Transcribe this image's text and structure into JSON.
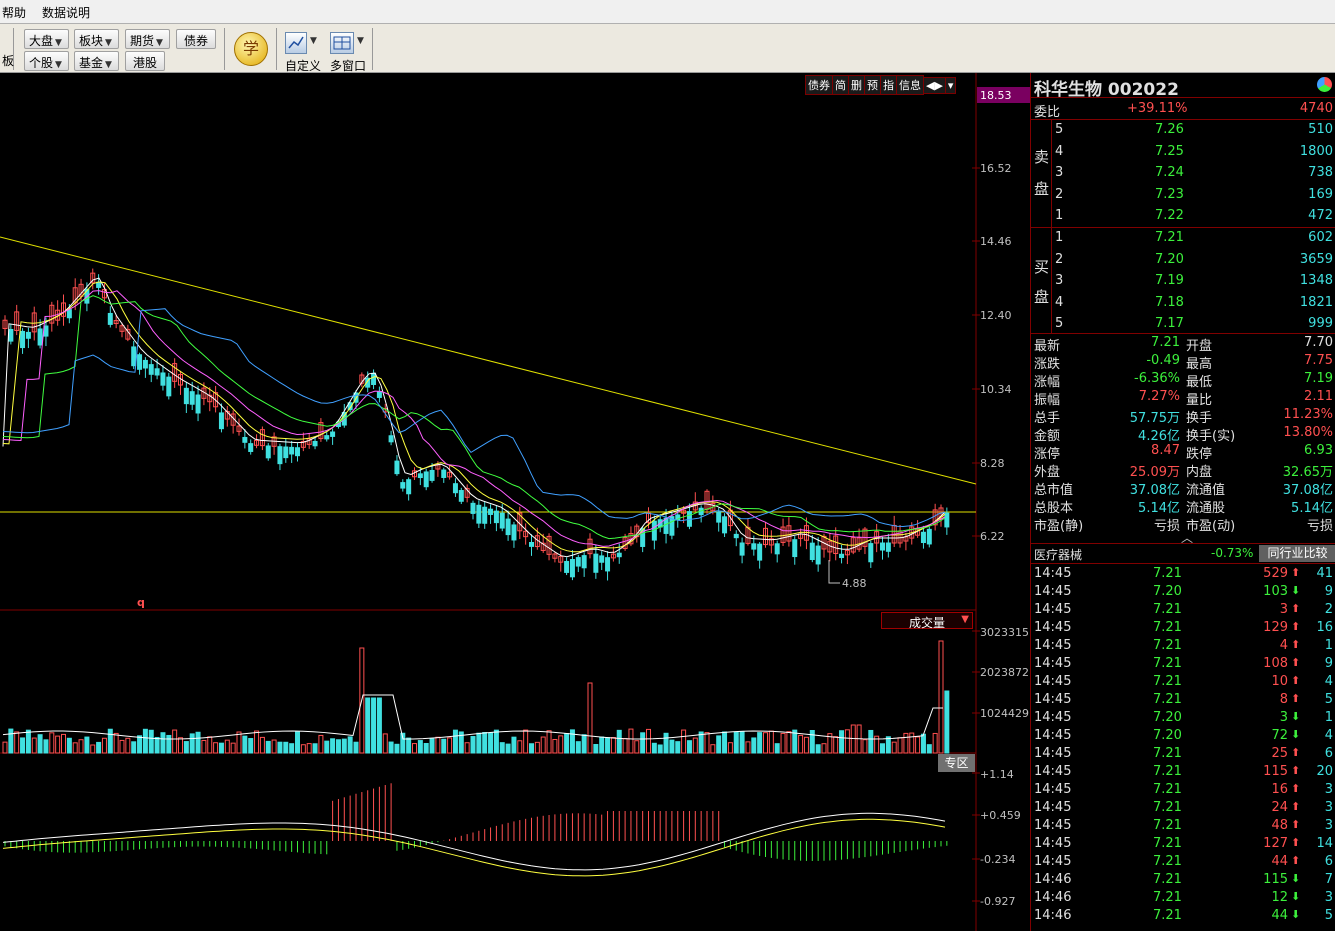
{
  "menu": [
    "帮助",
    "数据说明"
  ],
  "toolbar": {
    "left_edge": [
      "",
      "板"
    ],
    "row1": [
      "大盘",
      "板块",
      "期货",
      "债券"
    ],
    "row2": [
      "个股",
      "基金",
      "港股"
    ],
    "xue": "学",
    "custom": "自定义",
    "multi": "多窗口"
  },
  "chart_icons": [
    "债券",
    "简",
    "删",
    "预",
    "指",
    "信息",
    "◀▶"
  ],
  "price_axis": {
    "highlight": "18.53",
    "ticks": [
      "16.52",
      "14.46",
      "12.40",
      "10.34",
      "8.28",
      "6.22"
    ]
  },
  "annotations": {
    "low_label": "4.88",
    "q_mark": "q"
  },
  "volume": {
    "indicator": "成交量",
    "ticks": [
      "3023315",
      "2023872",
      "1024429"
    ],
    "zone_btn": "专区"
  },
  "macd": {
    "ticks": [
      "+1.14",
      "+0.459",
      "-0.234",
      "-0.927"
    ]
  },
  "stock": {
    "name": "科华生物",
    "code": "002022"
  },
  "weibi": {
    "label": "委比",
    "pct": "+39.11%",
    "diff": "4740"
  },
  "sell_label": [
    "卖",
    "盘"
  ],
  "buy_label": [
    "买",
    "盘"
  ],
  "sell": [
    [
      "5",
      "7.26",
      "510"
    ],
    [
      "4",
      "7.25",
      "1800"
    ],
    [
      "3",
      "7.24",
      "738"
    ],
    [
      "2",
      "7.23",
      "169"
    ],
    [
      "1",
      "7.22",
      "472"
    ]
  ],
  "buy": [
    [
      "1",
      "7.21",
      "602"
    ],
    [
      "2",
      "7.20",
      "3659"
    ],
    [
      "3",
      "7.19",
      "1348"
    ],
    [
      "4",
      "7.18",
      "1821"
    ],
    [
      "5",
      "7.17",
      "999"
    ]
  ],
  "stats": [
    [
      "最新",
      "7.21",
      "开盘",
      "7.70"
    ],
    [
      "涨跌",
      "-0.49",
      "最高",
      "7.75"
    ],
    [
      "涨幅",
      "-6.36%",
      "最低",
      "7.19"
    ],
    [
      "振幅",
      "7.27%",
      "量比",
      "2.11"
    ],
    [
      "总手",
      "57.75万",
      "换手",
      "11.23%"
    ],
    [
      "金额",
      "4.26亿",
      "换手(实)",
      "13.80%"
    ],
    [
      "涨停",
      "8.47",
      "跌停",
      "6.93"
    ],
    [
      "外盘",
      "25.09万",
      "内盘",
      "32.65万"
    ],
    [
      "总市值",
      "37.08亿",
      "流通值",
      "37.08亿"
    ],
    [
      "总股本",
      "5.14亿",
      "流通股",
      "5.14亿"
    ],
    [
      "市盈(静)",
      "亏损",
      "市盈(动)",
      "亏损"
    ]
  ],
  "industry": {
    "name": "医疗器械",
    "pct": "-0.73%",
    "button": "同行业比较"
  },
  "ticks": [
    [
      "14:45",
      "7.21",
      "529",
      "up",
      "41"
    ],
    [
      "14:45",
      "7.20",
      "103",
      "down",
      "9"
    ],
    [
      "14:45",
      "7.21",
      "3",
      "up",
      "2"
    ],
    [
      "14:45",
      "7.21",
      "129",
      "up",
      "16"
    ],
    [
      "14:45",
      "7.21",
      "4",
      "up",
      "1"
    ],
    [
      "14:45",
      "7.21",
      "108",
      "up",
      "9"
    ],
    [
      "14:45",
      "7.21",
      "10",
      "up",
      "4"
    ],
    [
      "14:45",
      "7.21",
      "8",
      "up",
      "5"
    ],
    [
      "14:45",
      "7.20",
      "3",
      "down",
      "1"
    ],
    [
      "14:45",
      "7.20",
      "72",
      "down",
      "4"
    ],
    [
      "14:45",
      "7.21",
      "25",
      "up",
      "6"
    ],
    [
      "14:45",
      "7.21",
      "115",
      "up",
      "20"
    ],
    [
      "14:45",
      "7.21",
      "16",
      "up",
      "3"
    ],
    [
      "14:45",
      "7.21",
      "24",
      "up",
      "3"
    ],
    [
      "14:45",
      "7.21",
      "48",
      "up",
      "3"
    ],
    [
      "14:45",
      "7.21",
      "127",
      "up",
      "14"
    ],
    [
      "14:45",
      "7.21",
      "44",
      "up",
      "6"
    ],
    [
      "14:46",
      "7.21",
      "115",
      "down",
      "7"
    ],
    [
      "14:46",
      "7.21",
      "12",
      "down",
      "3"
    ],
    [
      "14:46",
      "7.21",
      "44",
      "down",
      "5"
    ]
  ],
  "colors": {
    "up": "#ff5050",
    "down": "#3cf03c",
    "cyan": "#40e0e0",
    "yellow": "#e0e000",
    "border": "#800000"
  }
}
